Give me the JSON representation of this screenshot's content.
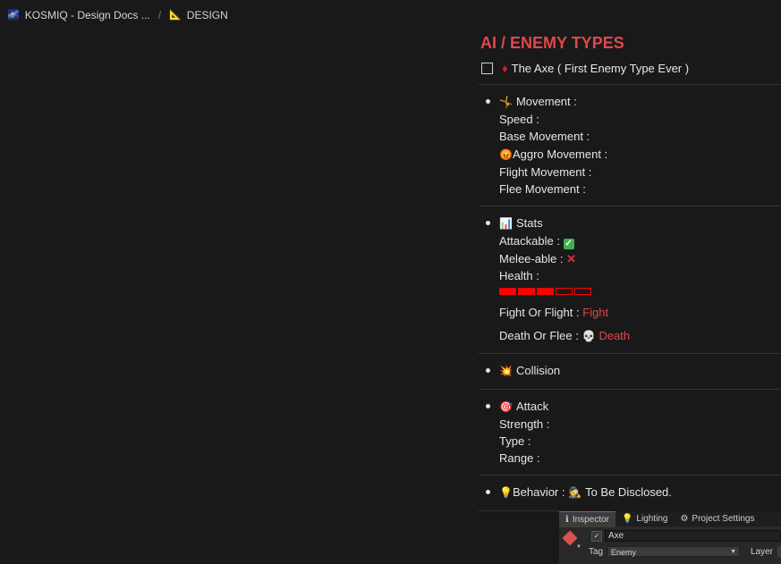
{
  "breadcrumb": {
    "items": [
      {
        "icon": "galaxy-icon",
        "label": "KOSMIQ - Design Docs ..."
      },
      {
        "icon": "triangle-ruler-icon",
        "label": "DESIGN"
      }
    ],
    "separator": "/"
  },
  "heading": "AI / ENEMY TYPES",
  "todo": {
    "checked": false,
    "text": "The Axe ( First Enemy Type Ever )"
  },
  "sections": {
    "movement": {
      "title": "Movement :",
      "speed": "Speed :",
      "base": "Base Movement :",
      "aggro": "Aggro Movement :",
      "flight": "Flight Movement :",
      "flee": "Flee Movement :"
    },
    "stats": {
      "title": "Stats",
      "attackable_label": "Attackable :",
      "attackable_value": true,
      "melee_label": "Melee-able :",
      "melee_value": false,
      "health_label": "Health :",
      "health": {
        "filled": 3,
        "total": 5
      },
      "fight_label": "Fight Or Flight :",
      "fight_value": "Fight",
      "death_label": "Death Or Flee :",
      "death_value": "Death"
    },
    "collision": {
      "title": "Collision"
    },
    "attack": {
      "title": "Attack",
      "strength": "Strength :",
      "type": "Type :",
      "range": "Range :"
    },
    "behavior": {
      "label": "Behavior :",
      "value": "To Be Disclosed."
    }
  },
  "inspector": {
    "tabs": [
      {
        "icon": "info-icon",
        "label": "Inspector"
      },
      {
        "icon": "bulb-icon",
        "label": "Lighting"
      },
      {
        "icon": "gear-icon",
        "label": "Project Settings"
      }
    ],
    "object_name": "Axe",
    "active": true,
    "tag_label": "Tag",
    "tag_value": "Enemy",
    "layer_label": "Layer"
  },
  "colors": {
    "heading": "#e0474c",
    "health": "#ff0000",
    "background": "#191919"
  }
}
